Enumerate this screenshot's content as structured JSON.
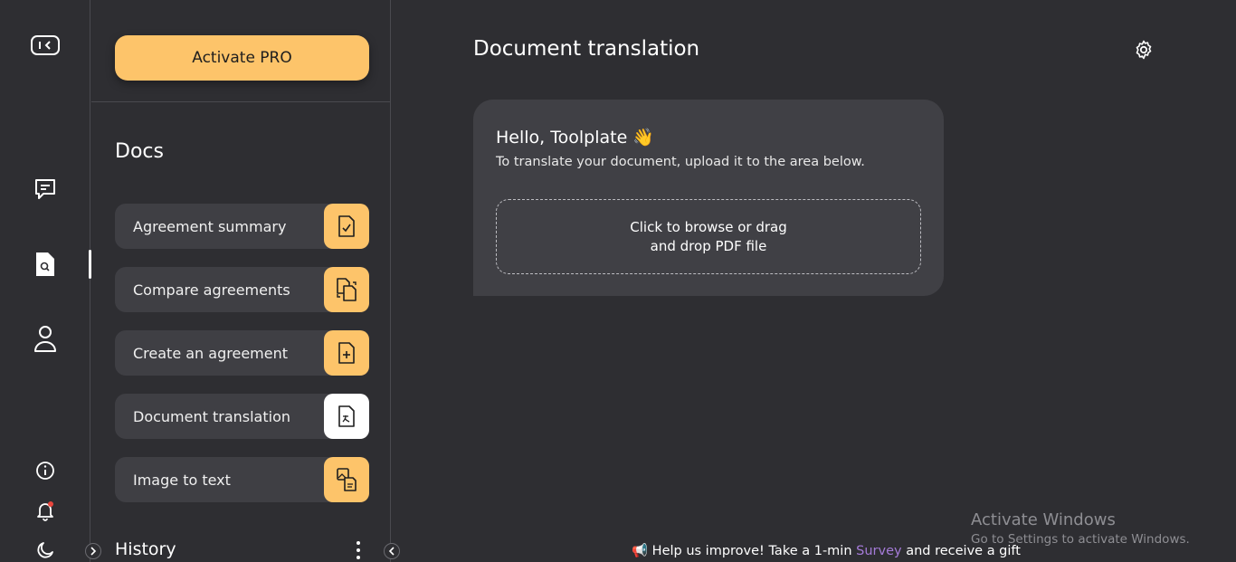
{
  "rail": {
    "icons": [
      "sidebar-toggle-icon",
      "chat-icon",
      "document-search-icon",
      "user-icon",
      "info-icon",
      "notification-bell-icon",
      "moon-icon"
    ]
  },
  "panel": {
    "pro_button": "Activate PRO",
    "docs_title": "Docs",
    "items": [
      {
        "label": "Agreement summary",
        "icon": "file-check-icon"
      },
      {
        "label": "Compare agreements",
        "icon": "file-compare-icon"
      },
      {
        "label": "Create an agreement",
        "icon": "file-plus-icon"
      },
      {
        "label": "Document translation",
        "icon": "file-translate-icon",
        "active": true
      },
      {
        "label": "Image to text",
        "icon": "image-to-text-icon"
      }
    ],
    "history_title": "History"
  },
  "main": {
    "title": "Document translation",
    "greeting": "Hello, Toolplate 👋",
    "subtitle": "To translate your document, upload it to the area below.",
    "dropzone_line1": "Click to browse or drag",
    "dropzone_line2": "and drop PDF file",
    "survey_prefix": "📢 Help us improve! Take a 1-min ",
    "survey_link": "Survey",
    "survey_suffix": " and receive a gift"
  },
  "watermark": {
    "line1": "Activate Windows",
    "line2": "Go to Settings to activate Windows."
  },
  "colors": {
    "background": "#2e2e32",
    "card": "#404045",
    "accent": "#fdc46a",
    "link": "#a57bd8"
  }
}
